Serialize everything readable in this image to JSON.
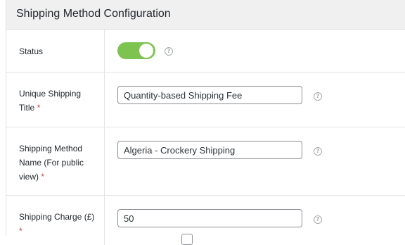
{
  "panel": {
    "title": "Shipping Method Configuration"
  },
  "rows": {
    "status": {
      "label": "Status",
      "enabled": true,
      "help": "?"
    },
    "unique_title": {
      "label": "Unique Shipping Title",
      "required_mark": "*",
      "value": "Quantity-based Shipping Fee",
      "help": "?"
    },
    "method_name": {
      "label": "Shipping Method Name (For public view)",
      "required_mark": "*",
      "value": "Algeria - Crockery Shipping",
      "help": "?"
    },
    "charge": {
      "label": "Shipping Charge (£)",
      "required_mark": "*",
      "value": "50",
      "help": "?"
    }
  },
  "colors": {
    "toggle_on": "#7cc34f",
    "required": "#d63638",
    "header_bg": "#f0f0f1"
  }
}
